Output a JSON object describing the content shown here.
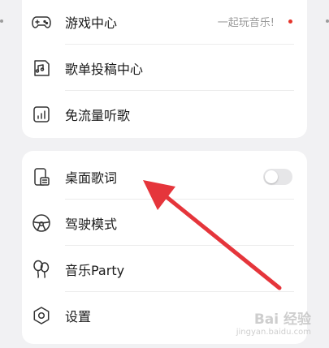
{
  "colors": {
    "background": "#f1f1f3",
    "card": "#ffffff",
    "text": "#1b1b1b",
    "hint": "#9a9a9a",
    "red_dot": "#e5352b",
    "arrow": "#e5353b",
    "toggle_off": "#e6e6e8"
  },
  "section1": {
    "items": [
      {
        "label": "游戏中心",
        "hint": "一起玩音乐!",
        "icon": "gamepad-icon",
        "badge": "red-dot"
      },
      {
        "label": "歌单投稿中心",
        "icon": "music-note-document-icon"
      },
      {
        "label": "免流量听歌",
        "icon": "signal-bars-icon"
      }
    ]
  },
  "section2": {
    "items": [
      {
        "label": "桌面歌词",
        "icon": "desktop-lyrics-icon",
        "toggle_on": false
      },
      {
        "label": "驾驶模式",
        "icon": "steering-wheel-icon"
      },
      {
        "label": "音乐Party",
        "icon": "balloons-icon"
      },
      {
        "label": "设置",
        "icon": "gear-icon"
      }
    ]
  },
  "overlay": {
    "annotation": "red-arrow-pointing-at-desktop-lyrics",
    "watermark_main": "Bai 经验",
    "watermark_sub": "jingyan.baidu.com"
  }
}
